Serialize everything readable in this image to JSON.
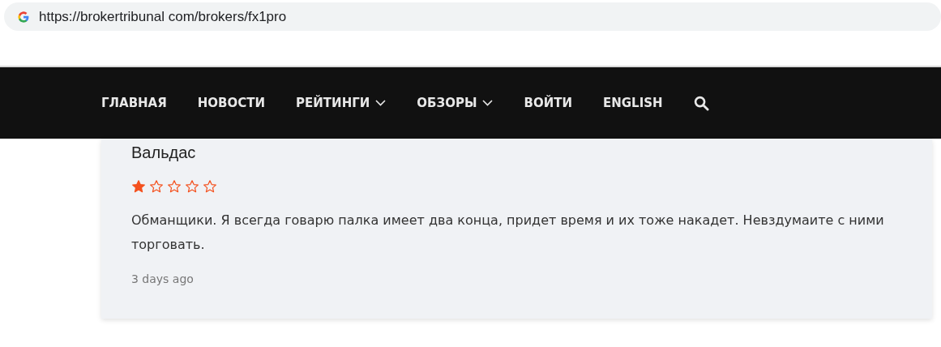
{
  "address_bar": {
    "url": "https://brokertribunal com/brokers/fx1pro"
  },
  "nav": {
    "items": [
      {
        "label": "ГЛАВНАЯ",
        "kind": "link"
      },
      {
        "label": "НОВОСТИ",
        "kind": "link"
      },
      {
        "label": "РЕЙТИНГИ",
        "kind": "dropdown"
      },
      {
        "label": "ОБЗОРЫ",
        "kind": "dropdown"
      },
      {
        "label": "ВОЙТИ",
        "kind": "link"
      },
      {
        "label": "ENGLISH",
        "kind": "link"
      }
    ]
  },
  "review": {
    "author": "Вальдас",
    "stars": 1,
    "text": "Обманщики. Я всегда говарю палка имеет два конца, придет время и их тоже накадет. Невздумаите с ними торговать.",
    "time": "3 days ago"
  }
}
